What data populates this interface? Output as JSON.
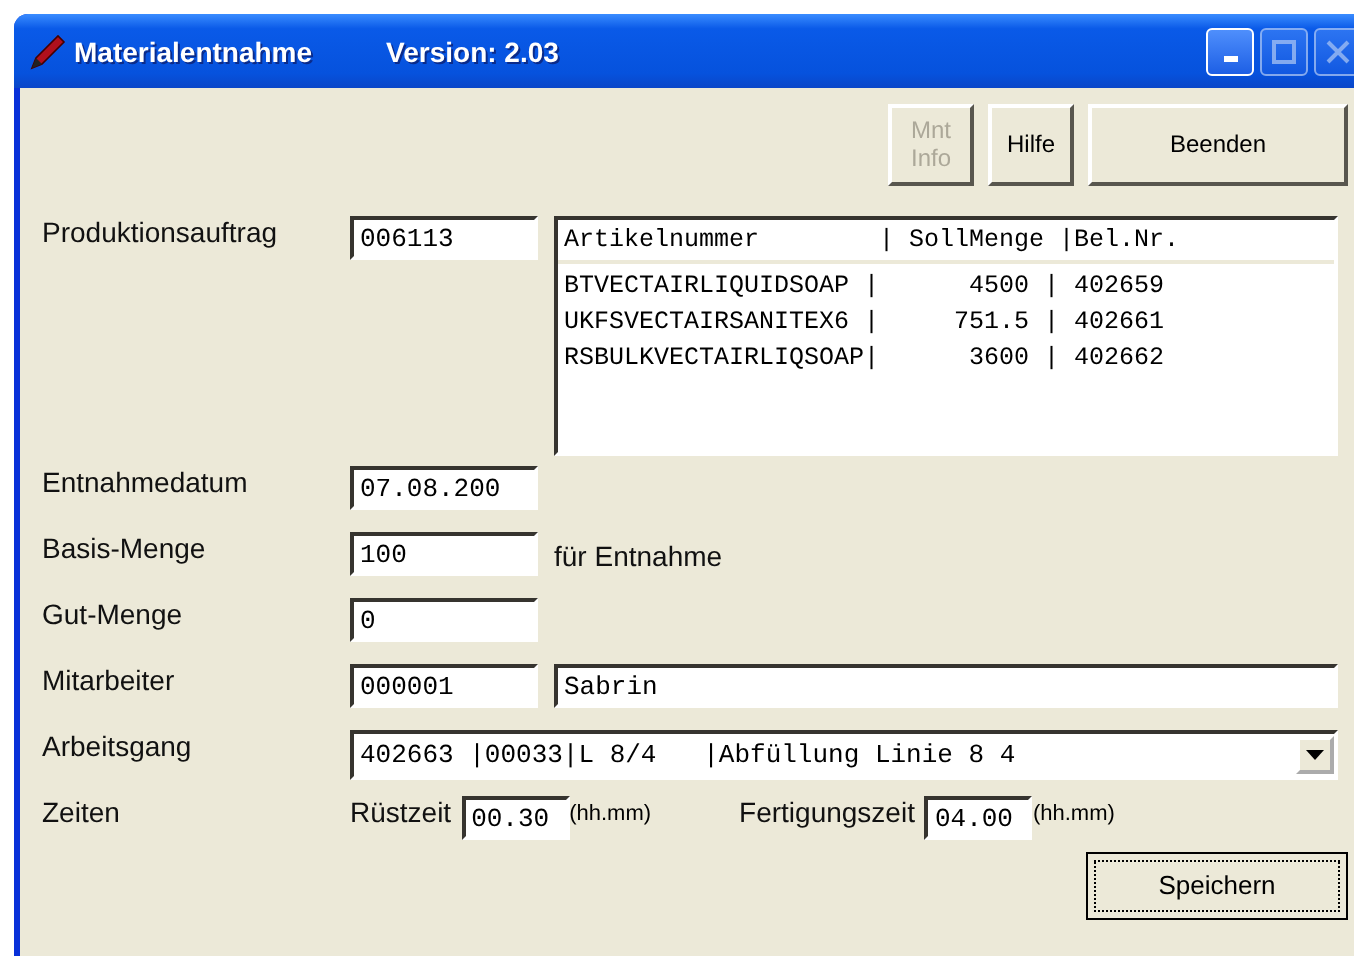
{
  "window": {
    "title": "Materialentnahme",
    "version": "Version: 2.03"
  },
  "title_buttons": [
    {
      "kind": "minimize",
      "disabled": false
    },
    {
      "kind": "maximize",
      "disabled": true
    },
    {
      "kind": "close",
      "disabled": true
    }
  ],
  "toolbar_buttons": [
    {
      "label": "Mnt\nInfo",
      "disabled": true
    },
    {
      "label": "Hilfe",
      "disabled": false
    },
    {
      "label": "Beenden",
      "disabled": false
    }
  ],
  "produktionsauftrag": {
    "label": "Produktionsauftrag",
    "value": "006113"
  },
  "list": {
    "header": "Artikelnummer        | SollMenge |Bel.Nr.",
    "rows": [
      "BTVECTAIRLIQUIDSOAP |      4500 | 402659",
      "UKFSVECTAIRSANITEX6 |     751.5 | 402661",
      "RSBULKVECTAIRLIQSOAP|      3600 | 402662"
    ]
  },
  "entnahmedatum": {
    "label": "Entnahmedatum",
    "value": "07.08.200"
  },
  "basis_menge": {
    "label": "Basis-Menge",
    "value": "100",
    "note": "für Entnahme"
  },
  "gut_menge": {
    "label": "Gut-Menge",
    "value": "0"
  },
  "mitarbeiter": {
    "label": "Mitarbeiter",
    "value": "000001",
    "name": "Sabrin"
  },
  "arbeitsgang": {
    "label": "Arbeitsgang",
    "value": "402663 |00033|L 8/4   |Abfüllung Linie 8 4"
  },
  "zeiten": {
    "label": "Zeiten",
    "ruest_label": "Rüstzeit",
    "ruest_value": "00.30",
    "ruest_unit": "(hh.mm)",
    "fert_label": "Fertigungszeit",
    "fert_value": "04.00",
    "fert_unit": "(hh.mm)"
  },
  "save_button": {
    "label": "Speichern",
    "focused": true
  }
}
